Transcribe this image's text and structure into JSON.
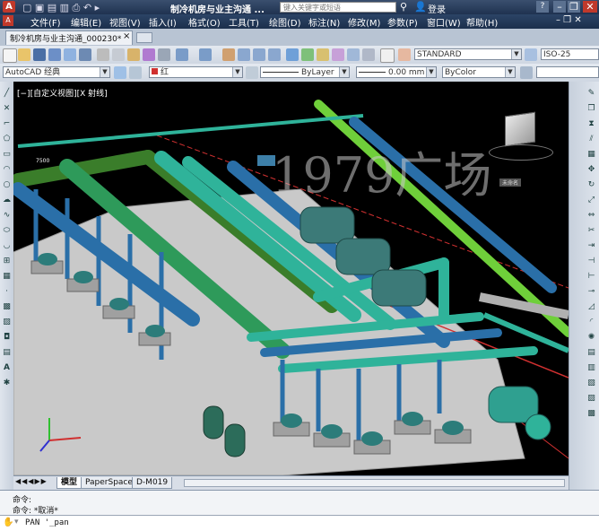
{
  "window": {
    "title": "制冷机房与业主沟通 ...",
    "search_placeholder": "键入关键字或短语",
    "login_label": "登录",
    "help_label": "?"
  },
  "menu": [
    "文件(F)",
    "编辑(E)",
    "视图(V)",
    "插入(I)",
    "格式(O)",
    "工具(T)",
    "绘图(D)",
    "标注(N)",
    "修改(M)",
    "参数(P)",
    "窗口(W)",
    "帮助(H)"
  ],
  "doc_tab": {
    "label": "制冷机房与业主沟通_000230*",
    "close": "×"
  },
  "toolbar": {
    "text_style": "STANDARD",
    "dim_style": "ISO-25",
    "workspace": "AutoCAD 经典",
    "layer_color": "红",
    "linetype": "ByLayer",
    "lineweight": "0.00 mm",
    "plot_color": "ByColor"
  },
  "viewport": {
    "label": "[−][自定义视图][X 射线]",
    "watermark": "1979广场",
    "viewcube_label": "未命名",
    "pipe_label": "7500"
  },
  "layout_tabs": [
    "模型",
    "PaperSpace",
    "D-M019"
  ],
  "command": {
    "history_1": "命令:",
    "history_2": "命令: *取消*",
    "current": "PAN '_pan"
  },
  "colors": {
    "pipe_teal": "#2fb39a",
    "pipe_blue": "#2a6fa8",
    "pipe_green": "#6fcf3a",
    "pipe_dark_green": "#3a7d2a",
    "floor": "#cfcfcf",
    "red_line": "#d03030"
  }
}
